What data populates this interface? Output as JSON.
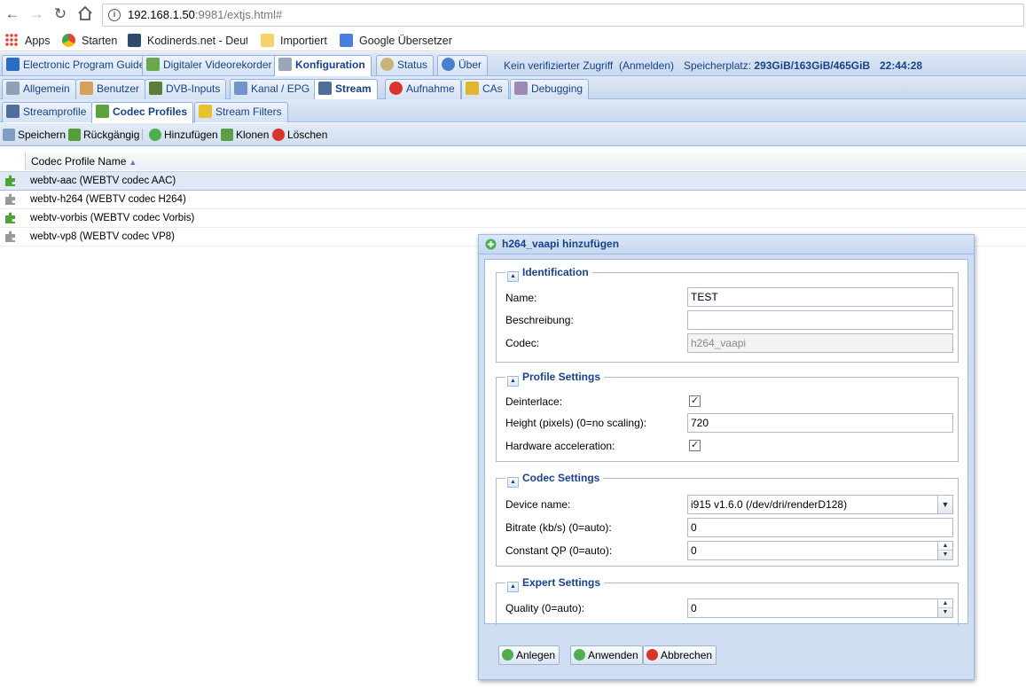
{
  "browser": {
    "url_host": "192.168.1.50",
    "url_rest": ":9981/extjs.html#",
    "bookmarks": [
      "Apps",
      "Starten",
      "Kodinerds.net - Deut",
      "Importiert",
      "Google Übersetzer"
    ]
  },
  "main_tabs": [
    "Electronic Program Guide",
    "Digitaler Videorekorder",
    "Konfiguration",
    "Status",
    "Über"
  ],
  "status": {
    "access": "Kein verifizierter Zugriff",
    "login": "(Anmelden)",
    "storage_label": "Speicherplatz:",
    "storage_value": "293GiB/163GiB/465GiB",
    "time": "22:44:28"
  },
  "config_tabs": [
    "Allgemein",
    "Benutzer",
    "DVB-Inputs",
    "Kanal / EPG",
    "Stream",
    "Aufnahme",
    "CAs",
    "Debugging"
  ],
  "stream_tabs": [
    "Streamprofile",
    "Codec Profiles",
    "Stream Filters"
  ],
  "toolbar": {
    "save": "Speichern",
    "undo": "Rückgängig",
    "add": "Hinzufügen",
    "clone": "Klonen",
    "delete": "Löschen"
  },
  "grid": {
    "column": "Codec Profile Name",
    "rows": [
      "webtv-aac (WEBTV codec AAC)",
      "webtv-h264 (WEBTV codec H264)",
      "webtv-vorbis (WEBTV codec Vorbis)",
      "webtv-vp8 (WEBTV codec VP8)"
    ]
  },
  "dialog": {
    "title": "h264_vaapi hinzufügen",
    "identification": {
      "legend": "Identification",
      "name_label": "Name:",
      "name_value": "TEST",
      "desc_label": "Beschreibung:",
      "desc_value": "",
      "codec_label": "Codec:",
      "codec_value": "h264_vaapi"
    },
    "profile": {
      "legend": "Profile Settings",
      "deinterlace_label": "Deinterlace:",
      "height_label": "Height (pixels) (0=no scaling):",
      "height_value": "720",
      "hwaccel_label": "Hardware acceleration:"
    },
    "codec": {
      "legend": "Codec Settings",
      "device_label": "Device name:",
      "device_value": "i915 v1.6.0 (/dev/dri/renderD128)",
      "bitrate_label": "Bitrate (kb/s) (0=auto):",
      "bitrate_value": "0",
      "qp_label": "Constant QP (0=auto):",
      "qp_value": "0"
    },
    "expert": {
      "legend": "Expert Settings",
      "quality_label": "Quality (0=auto):",
      "quality_value": "0"
    },
    "buttons": {
      "create": "Anlegen",
      "apply": "Anwenden",
      "cancel": "Abbrechen"
    }
  },
  "colors": {
    "accent": "#15428b",
    "tab_border": "#8db2e3",
    "selected_row": "#dfe8f6",
    "add_green": "#4caf50",
    "cancel_red": "#d9342b"
  }
}
